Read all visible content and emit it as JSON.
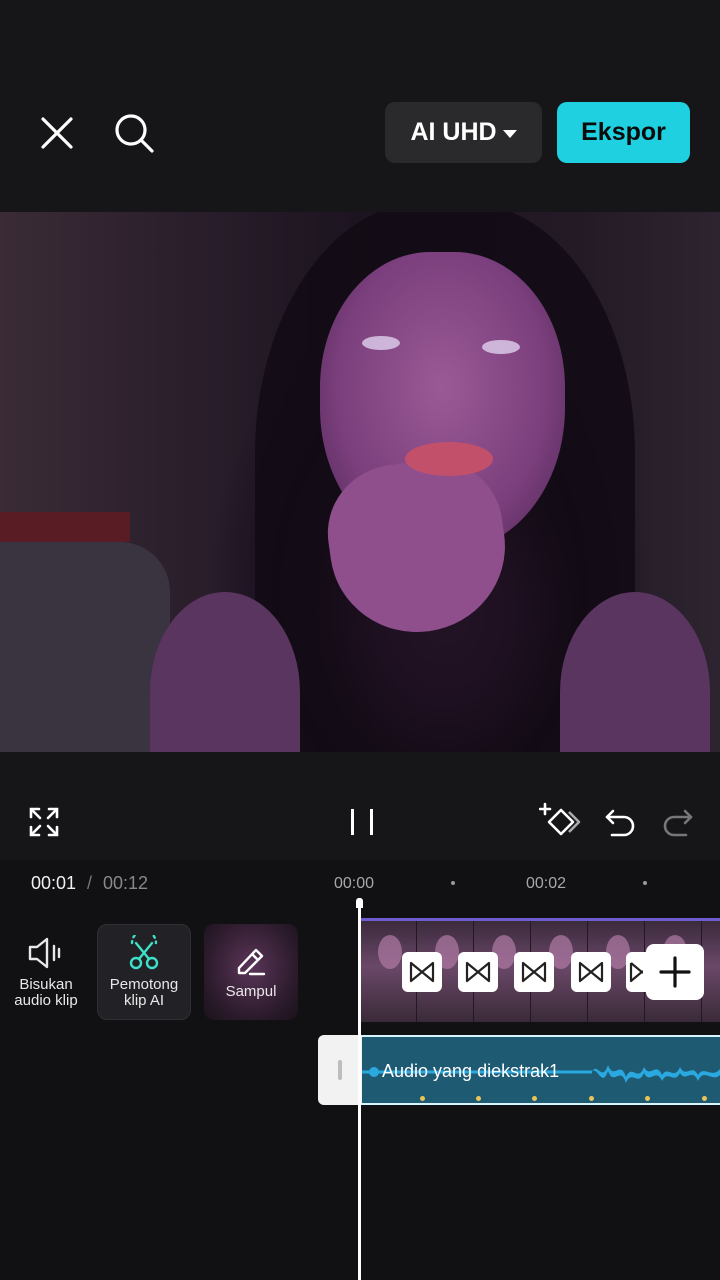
{
  "header": {
    "quality_label": "AI UHD",
    "export_label": "Ekspor"
  },
  "playback": {
    "current_time": "00:01",
    "separator": "/",
    "total_time": "00:12"
  },
  "ruler": {
    "labels": [
      "00:00",
      "00:02"
    ]
  },
  "tools": [
    {
      "label_line1": "Bisukan",
      "label_line2": "audio klip",
      "icon": "speaker-icon"
    },
    {
      "label_line1": "Pemotong",
      "label_line2": "klip AI",
      "icon": "ai-scissors-icon"
    },
    {
      "label_line1": "Sampul",
      "label_line2": "",
      "icon": "pencil-icon"
    }
  ],
  "audio_track": {
    "label": "Audio yang diekstrak1"
  },
  "colors": {
    "accent": "#1fd1e0",
    "audio_track": "#1f5a73",
    "video_track_border": "#6d5bd0",
    "ai_icon": "#3ee0c8"
  }
}
